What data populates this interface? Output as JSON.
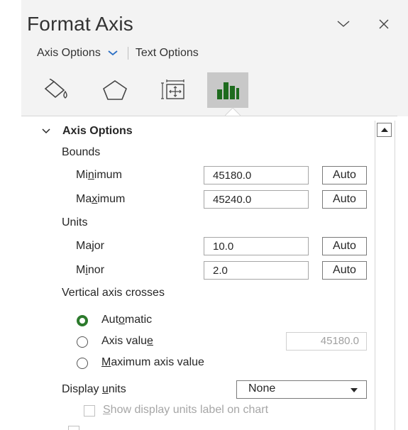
{
  "panel": {
    "title": "Format Axis"
  },
  "tabs": {
    "axis_options": "Axis Options",
    "text_options": "Text Options"
  },
  "category_icons": [
    "fill-line-icon",
    "effects-icon",
    "size-properties-icon",
    "axis-options-icon"
  ],
  "section": {
    "title": "Axis Options"
  },
  "bounds": {
    "label": "Bounds",
    "minimum": {
      "pre": "Mi",
      "u": "n",
      "post": "imum",
      "value": "45180.0",
      "auto": "Auto"
    },
    "maximum": {
      "pre": "Ma",
      "u": "x",
      "post": "imum",
      "value": "45240.0",
      "auto": "Auto"
    }
  },
  "units": {
    "label": "Units",
    "major": {
      "label": "Major",
      "value": "10.0",
      "auto": "Auto"
    },
    "minor": {
      "pre": "M",
      "u": "i",
      "post": "nor",
      "value": "2.0",
      "auto": "Auto"
    }
  },
  "crosses": {
    "label": "Vertical axis crosses",
    "automatic": {
      "pre": "Aut",
      "u": "o",
      "post": "matic",
      "selected": true
    },
    "axis_value": {
      "pre": "Axis valu",
      "u": "e",
      "post": "",
      "value": "45180.0",
      "selected": false
    },
    "maximum": {
      "pre": "",
      "u": "M",
      "post": "aximum axis value",
      "selected": false
    }
  },
  "display_units": {
    "pre": "Display ",
    "u": "u",
    "post": "nits",
    "value": "None",
    "show_label": {
      "pre": "",
      "u": "S",
      "post": "how display units label on chart"
    }
  },
  "colors": {
    "radio_selected": "#2c7a2c",
    "accent_chevron": "#2b6fc4",
    "active_icon": "#1e6b1e"
  }
}
